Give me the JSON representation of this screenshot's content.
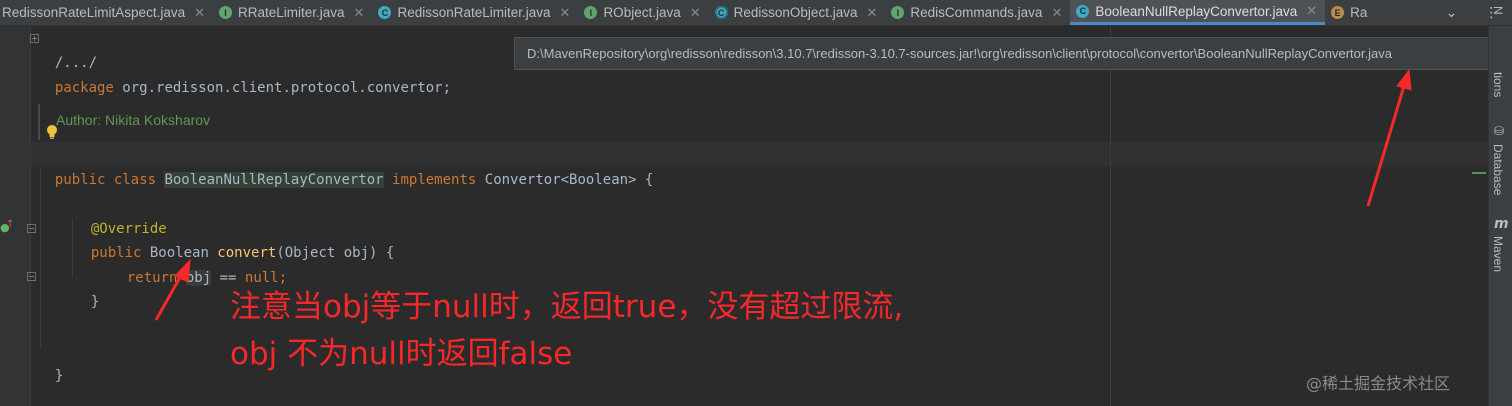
{
  "tabs": [
    {
      "label": "RedissonRateLimitAspect.java",
      "badge": "",
      "active": false
    },
    {
      "label": "RRateLimiter.java",
      "badge": "I",
      "active": false
    },
    {
      "label": "RedissonRateLimiter.java",
      "badge": "C",
      "active": false
    },
    {
      "label": "RObject.java",
      "badge": "I",
      "active": false
    },
    {
      "label": "RedissonObject.java",
      "badge": "C",
      "active": false
    },
    {
      "label": "RedisCommands.java",
      "badge": "I",
      "active": false
    },
    {
      "label": "BooleanNullReplayConvertor.java",
      "badge": "C",
      "active": true
    },
    {
      "label": "Ra",
      "badge": "E",
      "active": false
    }
  ],
  "tab_tools": {
    "dropdown": "⌄",
    "more": "⋮"
  },
  "tooltip": {
    "path": "D:\\MavenRepository\\org\\redisson\\redisson\\3.10.7\\redisson-3.10.7-sources.jar!\\org\\redisson\\client\\protocol\\convertor\\BooleanNullReplayConvertor.java"
  },
  "code": {
    "fold_comment": "/.../",
    "package_kw": "package",
    "package_name": " org.redisson.client.protocol.convertor;",
    "author": "Author: Nikita Koksharov",
    "public_kw": "public",
    "class_kw": " class ",
    "class_name": "BooleanNullReplayConvertor",
    "implements_kw": " implements ",
    "implements_type": "Convertor<Boolean> {",
    "override": "@Override",
    "method_public": "public",
    "method_return": " Boolean ",
    "method_name": "convert",
    "method_params": "(Object obj) {",
    "return_kw": "return",
    "return_obj": "obj",
    "return_rest_op": " == ",
    "return_null": "null",
    "return_semicolon": ";",
    "close_method": "}",
    "close_class": "}"
  },
  "right_strip": {
    "label_top": "tions",
    "label_top_prefix": "N",
    "database": "Database",
    "maven": "Maven",
    "maven_icon": "m"
  },
  "annotation": {
    "line1": "注意当obj等于null时，返回true，没有超过限流,",
    "line2": "obj 不为null时返回false"
  },
  "watermark": "@稀土掘金技术社区",
  "colors": {
    "accent": "#4a88c7",
    "annotation": "#f5282a"
  }
}
